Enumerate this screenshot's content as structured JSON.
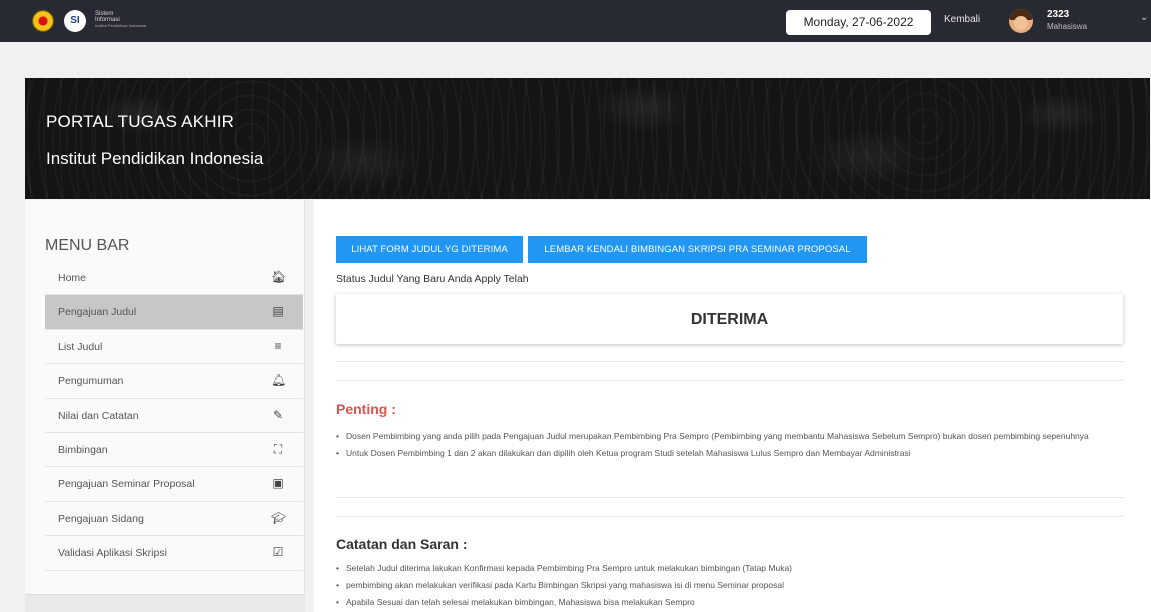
{
  "topbar": {
    "logo_ipi_icon": "ipi-logo-icon",
    "logo_si": {
      "letters": "SI",
      "line1": "Sistem",
      "line2": "Informasi",
      "line3": "Institut Pendidikan Indonesia"
    },
    "date": "Monday, 27-06-2022",
    "back_label": "Kembali",
    "user": {
      "id": "2323",
      "role": "Mahasiswa"
    },
    "caret": "⌄"
  },
  "banner": {
    "title": "PORTAL TUGAS AKHIR",
    "subtitle": "Institut Pendidikan Indonesia"
  },
  "sidebar": {
    "title": "MENU BAR",
    "items": [
      {
        "label": "Home",
        "icon": "🏠︎",
        "icon_name": "home-icon",
        "active": false
      },
      {
        "label": "Pengajuan Judul",
        "icon": "▤",
        "icon_name": "file-icon",
        "active": true
      },
      {
        "label": "List Judul",
        "icon": "≡",
        "icon_name": "list-icon",
        "active": false
      },
      {
        "label": "Pengumuman",
        "icon": "🔔︎",
        "icon_name": "bell-icon",
        "active": false
      },
      {
        "label": "Nilai dan Catatan",
        "icon": "✎",
        "icon_name": "edit-icon",
        "active": false
      },
      {
        "label": "Bimbingan",
        "icon": "⛶",
        "icon_name": "expand-icon",
        "active": false
      },
      {
        "label": "Pengajuan Seminar Proposal",
        "icon": "▣",
        "icon_name": "clipboard-icon",
        "active": false
      },
      {
        "label": "Pengajuan Sidang",
        "icon": "🎓︎",
        "icon_name": "graduation-cap-icon",
        "active": false
      },
      {
        "label": "Validasi Aplikasi Skripsi",
        "icon": "☑",
        "icon_name": "check-square-icon",
        "active": false
      }
    ]
  },
  "main": {
    "buttons": {
      "view_form": "LIHAT FORM JUDUL YG DITERIMA",
      "control_sheet": "LEMBAR KENDALI BIMBINGAN SKRIPSI PRA SEMINAR PROPOSAL"
    },
    "status_label": "Status Judul Yang Baru Anda Apply Telah",
    "status_value": "DITERIMA",
    "penting": {
      "title": "Penting :",
      "items": [
        "Dosen Pembimbing yang anda pilih pada Pengajuan Judul merupakan Pembimbing Pra Sempro (Pembimbing yang membantu Mahasiswa Sebelum Sempro) bukan dosen pembimbing sepenuhnya",
        "Untuk Dosen Pembimbing 1 dan 2 akan dilakukan dan dipilih oleh Ketua program Studi setelah Mahasiswa Lulus Sempro dan Membayar Administrasi"
      ]
    },
    "catatan": {
      "title": "Catatan dan Saran :",
      "items": [
        "Setelah Judul diterima lakukan Konfirmasi kepada Pembimbing Pra Sempro untuk melakukan bimbingan (Tatap Muka)",
        "pembimbing akan melakukan verifikasi pada Kartu Bimbingan Skripsi yang mahasiswa isi di menu Seminar proposal",
        "Apabila Sesuai dan telah selesai melakukan bimbingan, Mahasiswa bisa melakukan Sempro"
      ]
    }
  }
}
